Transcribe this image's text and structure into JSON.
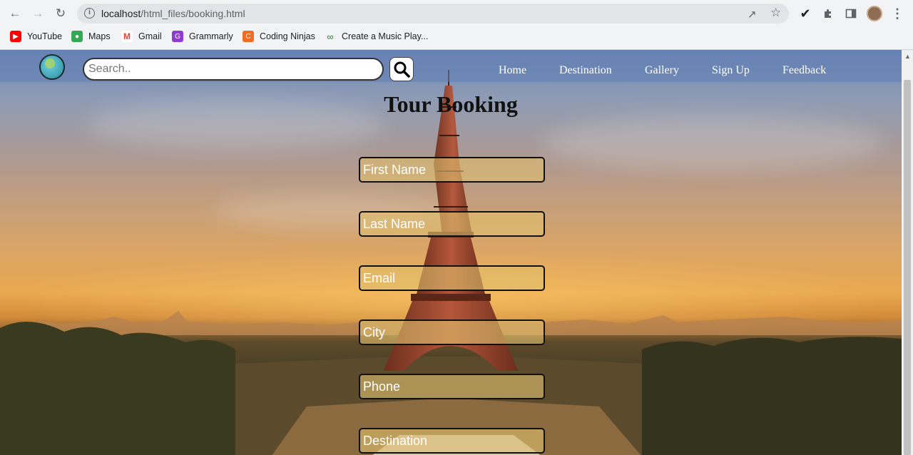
{
  "browser": {
    "url_host": "localhost",
    "url_path": "/html_files/booking.html",
    "bookmarks": [
      {
        "label": "YouTube",
        "icon": "youtube-icon",
        "color": "#ff0000"
      },
      {
        "label": "Maps",
        "icon": "maps-icon",
        "color": "#34a853"
      },
      {
        "label": "Gmail",
        "icon": "gmail-icon",
        "color": "#ea4335"
      },
      {
        "label": "Grammarly",
        "icon": "grammarly-icon",
        "color": "#8e3bd0"
      },
      {
        "label": "Coding Ninjas",
        "icon": "coding-ninjas-icon",
        "color": "#f26b21"
      },
      {
        "label": "Create a Music Play...",
        "icon": "link-icon",
        "color": "#2e7d32"
      }
    ]
  },
  "site": {
    "search": {
      "placeholder": "Search.."
    },
    "nav": [
      "Home",
      "Destination",
      "Gallery",
      "Sign Up",
      "Feedback"
    ],
    "accent_header": "#5f7db4"
  },
  "form": {
    "title": "Tour Booking",
    "fields": [
      {
        "placeholder": "First Name"
      },
      {
        "placeholder": "Last Name"
      },
      {
        "placeholder": "Email"
      },
      {
        "placeholder": "City"
      },
      {
        "placeholder": "Phone"
      },
      {
        "placeholder": "Destination"
      }
    ]
  }
}
